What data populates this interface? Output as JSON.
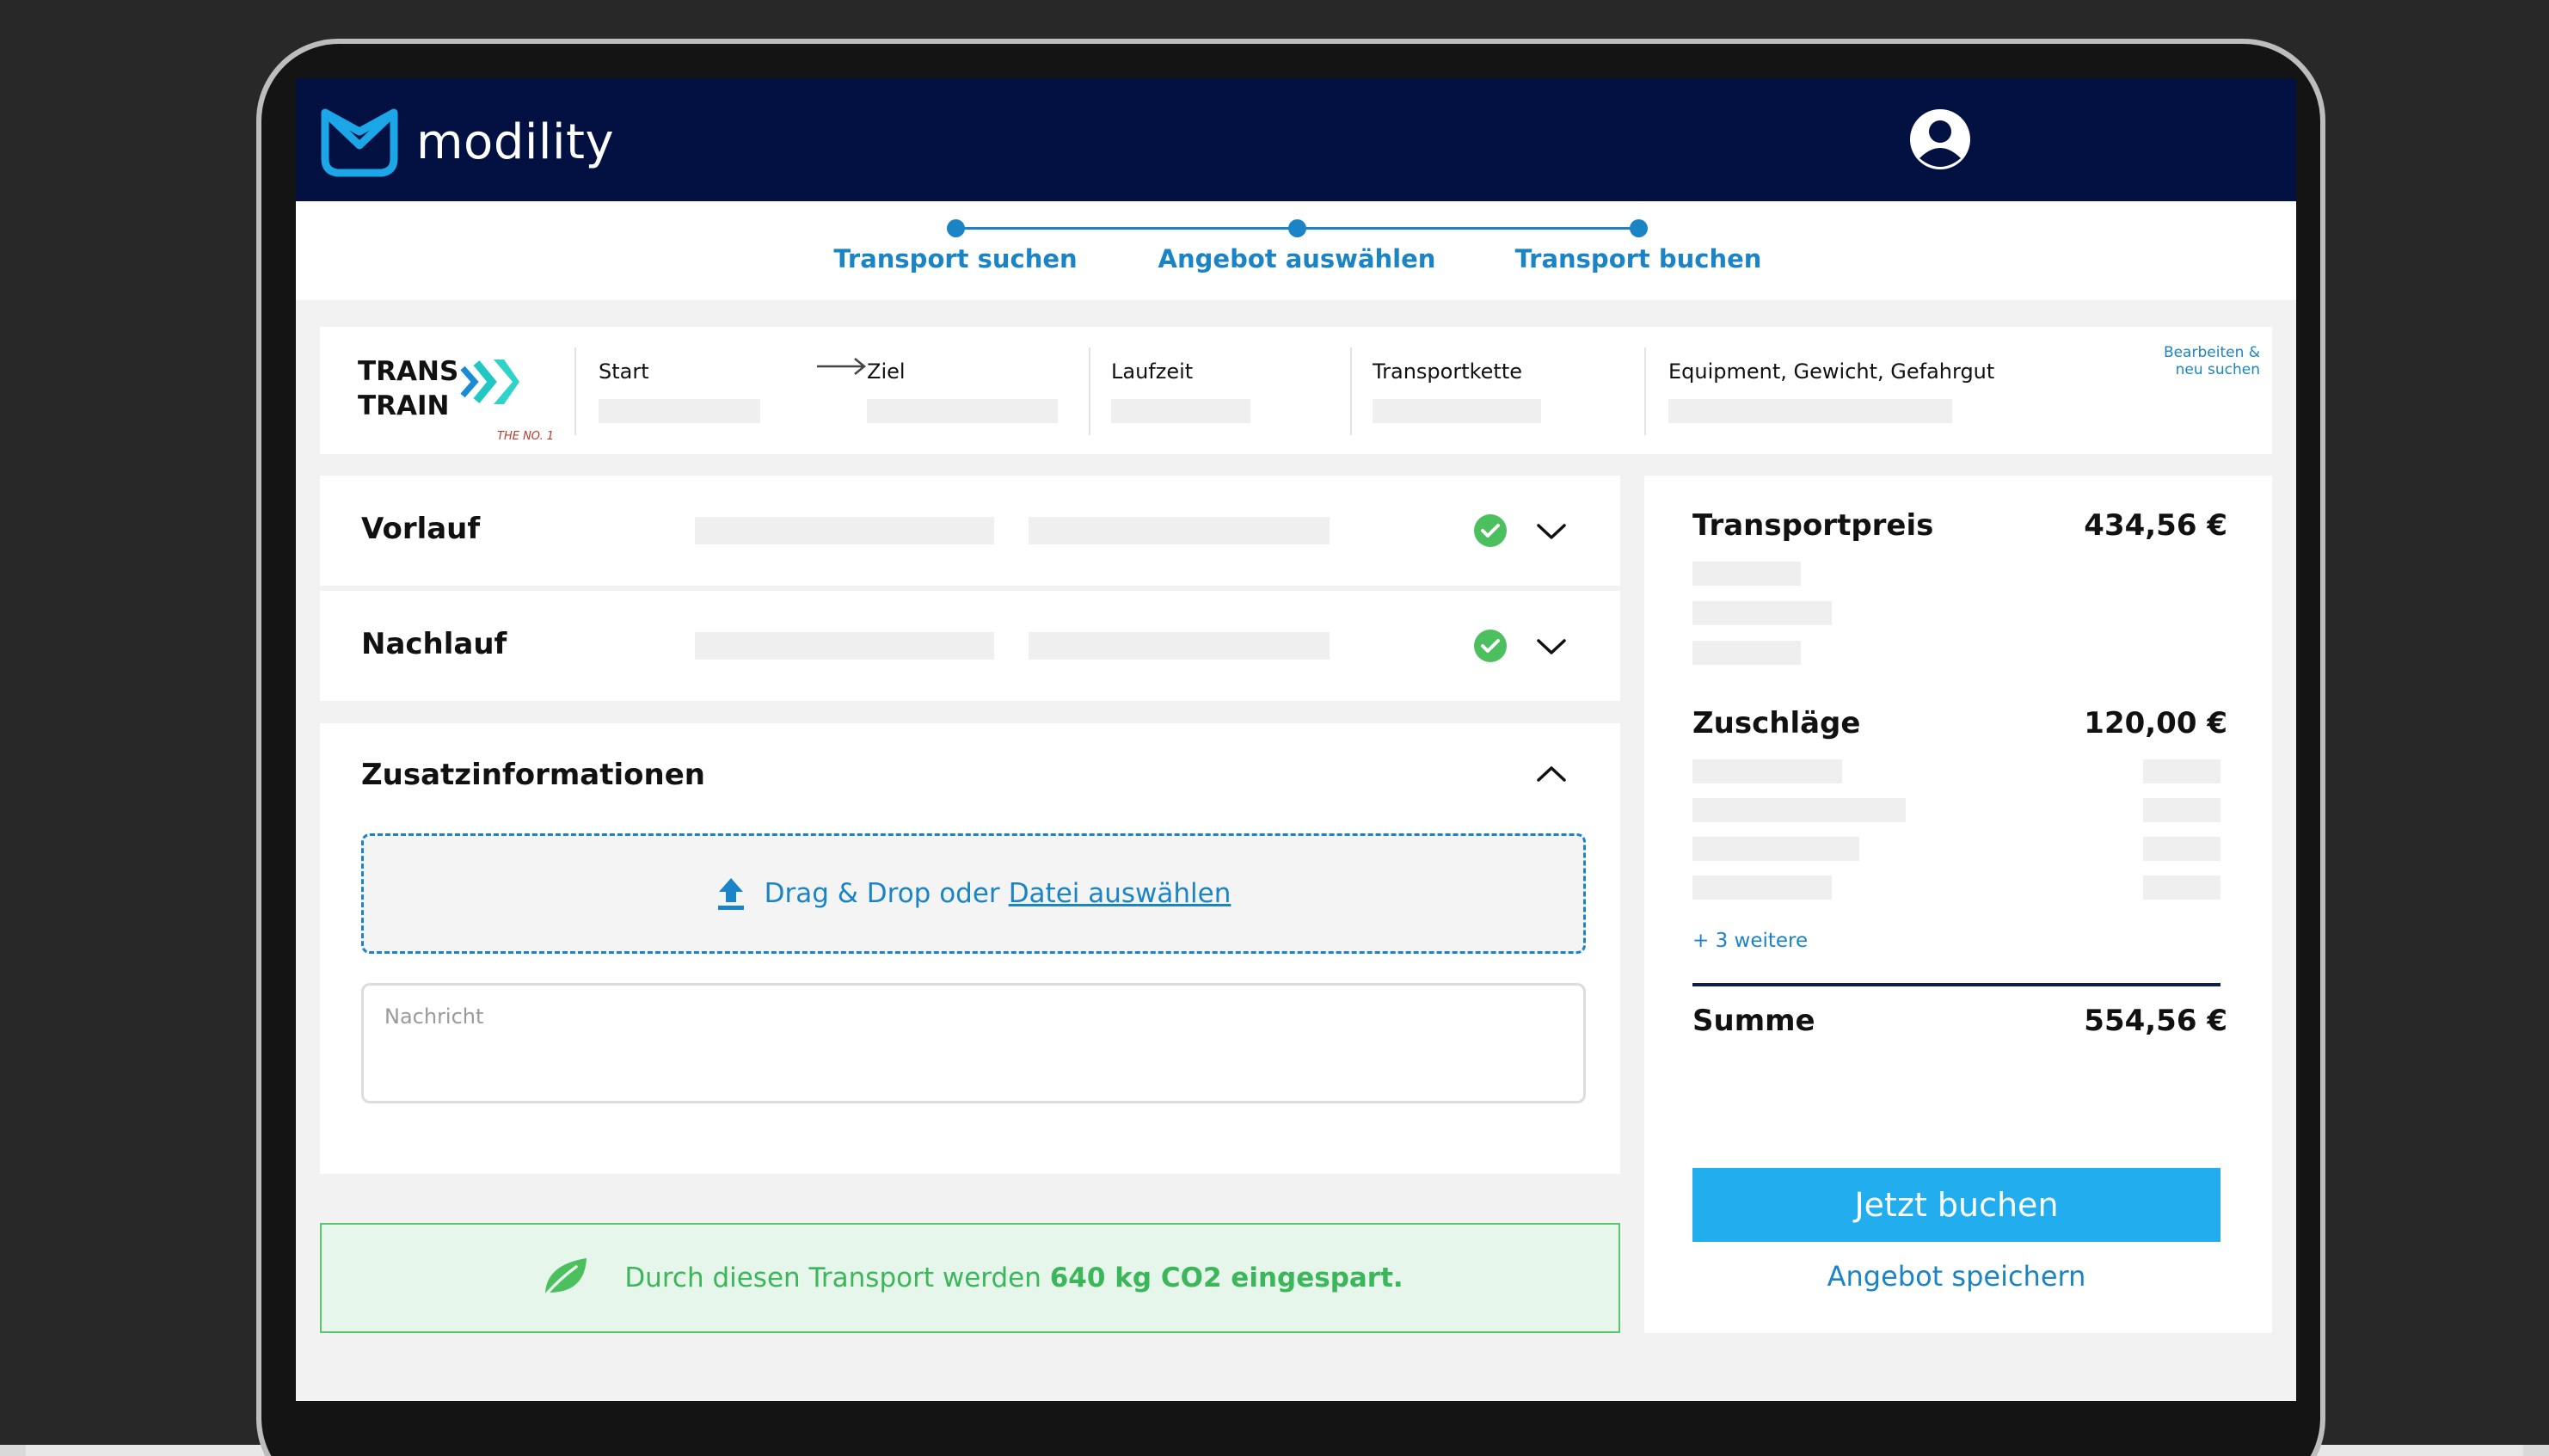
{
  "app": {
    "brand": "modility"
  },
  "stepper": {
    "steps": [
      {
        "label": "Transport suchen"
      },
      {
        "label": "Angebot auswählen"
      },
      {
        "label": "Transport buchen"
      }
    ]
  },
  "info_bar": {
    "operator_line1": "TRANS",
    "operator_line2": "TRAIN",
    "operator_tagline": "THE NO. 1",
    "start_label": "Start",
    "ziel_label": "Ziel",
    "laufzeit_label": "Laufzeit",
    "kette_label": "Transportkette",
    "equipment_label": "Equipment, Gewicht, Gefahrgut",
    "edit_line1": "Bearbeiten &",
    "edit_line2": "neu suchen"
  },
  "legs": {
    "vorlauf": {
      "title": "Vorlauf"
    },
    "nachlauf": {
      "title": "Nachlauf"
    }
  },
  "extra": {
    "title": "Zusatzinformationen",
    "dropzone_text": "Drag & Drop oder",
    "dropzone_link": "Datei auswählen",
    "message_placeholder": "Nachricht"
  },
  "co2": {
    "text": "Durch diesen Transport werden",
    "highlight": "640 kg CO2 eingespart."
  },
  "price": {
    "transport_label": "Transportpreis",
    "transport_value": "434,56 €",
    "surcharge_label": "Zuschläge",
    "surcharge_value": "120,00 €",
    "more_link": "+ 3 weitere",
    "sum_label": "Summe",
    "sum_value": "554,56 €",
    "book_button": "Jetzt buchen",
    "save_link": "Angebot speichern"
  },
  "colors": {
    "header_bg": "#021142",
    "accent_blue": "#1a84c6",
    "button_blue": "#22aeee",
    "success_green": "#4cbf5f"
  },
  "icons": {
    "logo": "modility-logo-icon",
    "avatar": "user-avatar-icon",
    "arrow": "arrow-right-icon",
    "check": "check-circle-icon",
    "expand": "chevron-down-icon",
    "collapse": "chevron-up-icon",
    "upload": "upload-icon",
    "leaf": "leaf-icon"
  }
}
